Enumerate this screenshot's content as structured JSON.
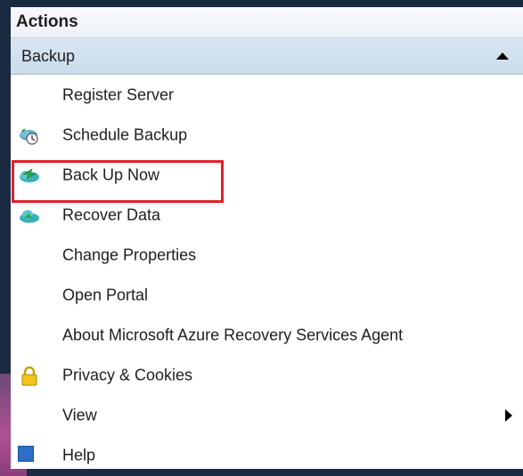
{
  "panel": {
    "title": "Actions",
    "section": {
      "label": "Backup"
    },
    "items": [
      {
        "label": "Register Server",
        "icon": ""
      },
      {
        "label": "Schedule Backup",
        "icon": "schedule-backup-icon"
      },
      {
        "label": "Back Up Now",
        "icon": "backup-now-icon"
      },
      {
        "label": "Recover Data",
        "icon": "recover-data-icon"
      },
      {
        "label": "Change Properties",
        "icon": ""
      },
      {
        "label": "Open Portal",
        "icon": ""
      },
      {
        "label": "About Microsoft Azure Recovery Services Agent",
        "icon": ""
      },
      {
        "label": "Privacy & Cookies",
        "icon": "lock-icon"
      },
      {
        "label": "View",
        "icon": ""
      },
      {
        "label": "Help",
        "icon": "help-icon"
      }
    ]
  },
  "colors": {
    "highlight": "#e0202a",
    "section_bg": "#d9e6f2",
    "cloud_green": "#2aa84a",
    "cloud_teal": "#3bb0b8"
  }
}
